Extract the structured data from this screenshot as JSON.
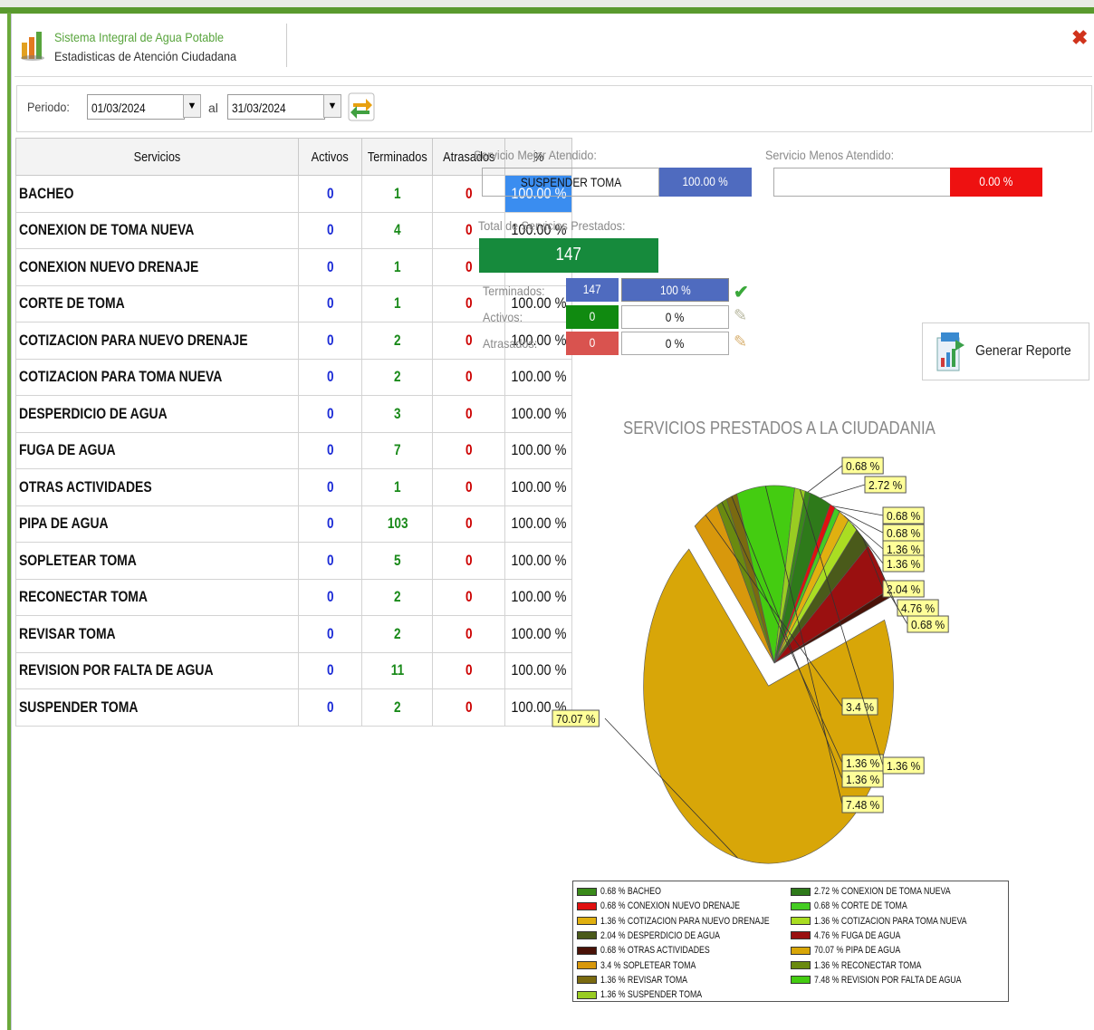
{
  "app": {
    "title": "Sistema Integral de Agua Potable",
    "subtitle": "Estadisticas de Atención Ciudadana",
    "close_icon": "close-icon"
  },
  "filter": {
    "periodo_label": "Periodo:",
    "date_from": "01/03/2024",
    "al_label": "al",
    "date_to": "31/03/2024"
  },
  "table": {
    "headers": [
      "Servicios",
      "Activos",
      "Terminados",
      "Atrasados",
      "%"
    ],
    "rows": [
      {
        "name": "BACHEO",
        "activos": "0",
        "terminados": "1",
        "atrasados": "0",
        "pct": "100.00 %"
      },
      {
        "name": "CONEXION DE TOMA NUEVA",
        "activos": "0",
        "terminados": "4",
        "atrasados": "0",
        "pct": "100.00 %"
      },
      {
        "name": "CONEXION NUEVO DRENAJE",
        "activos": "0",
        "terminados": "1",
        "atrasados": "0",
        "pct": "100.00 %"
      },
      {
        "name": "CORTE DE TOMA",
        "activos": "0",
        "terminados": "1",
        "atrasados": "0",
        "pct": "100.00 %"
      },
      {
        "name": "COTIZACION PARA NUEVO DRENAJE",
        "activos": "0",
        "terminados": "2",
        "atrasados": "0",
        "pct": "100.00 %"
      },
      {
        "name": "COTIZACION PARA TOMA NUEVA",
        "activos": "0",
        "terminados": "2",
        "atrasados": "0",
        "pct": "100.00 %"
      },
      {
        "name": "DESPERDICIO DE AGUA",
        "activos": "0",
        "terminados": "3",
        "atrasados": "0",
        "pct": "100.00 %"
      },
      {
        "name": "FUGA DE AGUA",
        "activos": "0",
        "terminados": "7",
        "atrasados": "0",
        "pct": "100.00 %"
      },
      {
        "name": "OTRAS ACTIVIDADES",
        "activos": "0",
        "terminados": "1",
        "atrasados": "0",
        "pct": "100.00 %"
      },
      {
        "name": "PIPA DE AGUA",
        "activos": "0",
        "terminados": "103",
        "atrasados": "0",
        "pct": "100.00 %"
      },
      {
        "name": "SOPLETEAR TOMA",
        "activos": "0",
        "terminados": "5",
        "atrasados": "0",
        "pct": "100.00 %"
      },
      {
        "name": "RECONECTAR TOMA",
        "activos": "0",
        "terminados": "2",
        "atrasados": "0",
        "pct": "100.00 %"
      },
      {
        "name": "REVISAR TOMA",
        "activos": "0",
        "terminados": "2",
        "atrasados": "0",
        "pct": "100.00 %"
      },
      {
        "name": "REVISION POR FALTA DE AGUA",
        "activos": "0",
        "terminados": "11",
        "atrasados": "0",
        "pct": "100.00 %"
      },
      {
        "name": "SUSPENDER TOMA",
        "activos": "0",
        "terminados": "2",
        "atrasados": "0",
        "pct": "100.00 %"
      }
    ]
  },
  "summary": {
    "best_label": "Servicio Mejor Atendido:",
    "best_name": "SUSPENDER TOMA",
    "best_pct": "100.00 %",
    "worst_label": "Servicio Menos Atendido:",
    "worst_name": "",
    "worst_pct": "0.00 %",
    "total_label": "Total de Servicios Prestados:",
    "total": "147",
    "terminados_label": "Terminados:",
    "terminados_count": "147",
    "terminados_pct": "100 %",
    "activos_label": "Activos:",
    "activos_count": "0",
    "activos_pct": "0 %",
    "atrasados_label": "Atrasados:",
    "atrasados_count": "0",
    "atrasados_pct": "0 %",
    "colors": {
      "best": "#4f6bbf",
      "worst": "#ee1111",
      "total": "#168a3c",
      "terminados": "#4f6bbf",
      "activos": "#108a10",
      "atrasados": "#d9534f"
    }
  },
  "report_button": {
    "label": "Generar Reporte",
    "icon": "report-icon"
  },
  "chart_data": {
    "type": "pie",
    "title": "SERVICIOS PRESTADOS A LA CIUDADANIA",
    "slices": [
      {
        "label": "0.68 % BACHEO",
        "value": 0.68,
        "pct_label": "0.68 %",
        "color": "#3a8a1a"
      },
      {
        "label": "2.72 % CONEXION DE TOMA NUEVA",
        "value": 2.72,
        "pct_label": "2.72 %",
        "color": "#2e7a1a"
      },
      {
        "label": "0.68 % CONEXION NUEVO DRENAJE",
        "value": 0.68,
        "pct_label": "0.68 %",
        "color": "#e01010"
      },
      {
        "label": "0.68 % CORTE DE TOMA",
        "value": 0.68,
        "pct_label": "0.68 %",
        "color": "#44cc22"
      },
      {
        "label": "1.36 % COTIZACION PARA NUEVO DRENAJE",
        "value": 1.36,
        "pct_label": "1.36 %",
        "color": "#e0b010"
      },
      {
        "label": "1.36 % COTIZACION PARA TOMA NUEVA",
        "value": 1.36,
        "pct_label": "1.36 %",
        "color": "#aadd22"
      },
      {
        "label": "2.04 % DESPERDICIO DE AGUA",
        "value": 2.04,
        "pct_label": "2.04 %",
        "color": "#4a5a1a"
      },
      {
        "label": "4.76 % FUGA DE AGUA",
        "value": 4.76,
        "pct_label": "4.76 %",
        "color": "#9a1010"
      },
      {
        "label": "0.68 % OTRAS ACTIVIDADES",
        "value": 0.68,
        "pct_label": "0.68 %",
        "color": "#4a1208"
      },
      {
        "label": "70.07 % PIPA DE AGUA",
        "value": 70.07,
        "pct_label": "70.07 %",
        "color": "#d8a608"
      },
      {
        "label": "3.4 % SOPLETEAR TOMA",
        "value": 3.4,
        "pct_label": "3.4 %",
        "color": "#d8980c"
      },
      {
        "label": "1.36 % RECONECTAR TOMA",
        "value": 1.36,
        "pct_label": "1.36 %",
        "color": "#6a8a10"
      },
      {
        "label": "1.36 % REVISAR TOMA",
        "value": 1.36,
        "pct_label": "1.36 %",
        "color": "#7a6a10"
      },
      {
        "label": "7.48 % REVISION POR FALTA DE AGUA",
        "value": 7.48,
        "pct_label": "7.48 %",
        "color": "#44cc11"
      },
      {
        "label": "1.36 % SUSPENDER TOMA",
        "value": 1.36,
        "pct_label": "1.36 %",
        "color": "#99cc22"
      }
    ],
    "legend_placement": "bottom"
  }
}
